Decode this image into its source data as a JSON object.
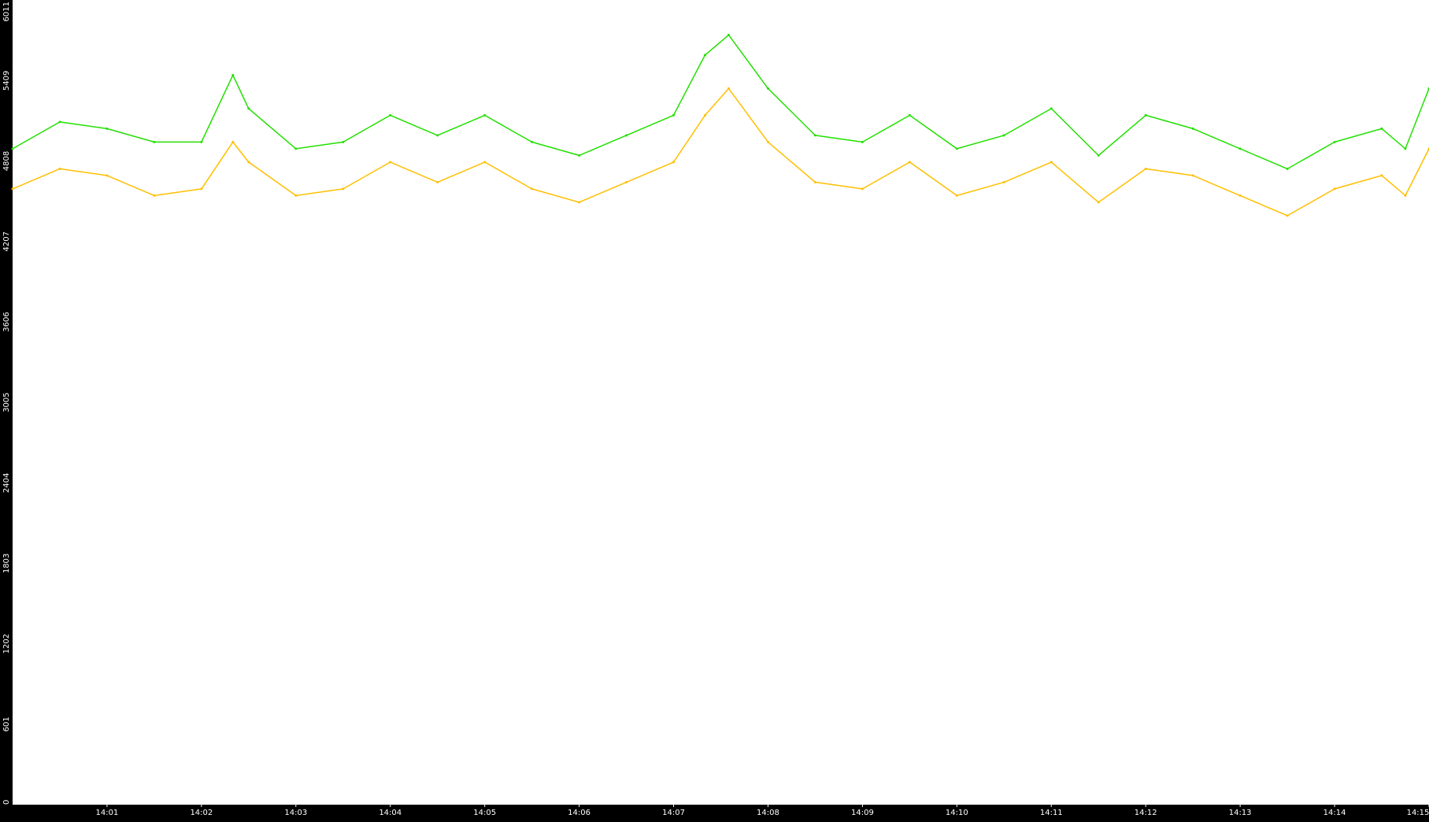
{
  "chart_data": {
    "type": "line",
    "title": "",
    "xlabel": "",
    "ylabel": "",
    "grid": false,
    "legend": "none",
    "colors": {
      "background": "#000000",
      "plot_area": "#ffffff",
      "axis_text": "#ffffff"
    },
    "ylim": [
      0,
      6011
    ],
    "y_ticks": [
      {
        "value": 0,
        "label": "0"
      },
      {
        "value": 601,
        "label": "601"
      },
      {
        "value": 1202,
        "label": "1202"
      },
      {
        "value": 1803,
        "label": "1803"
      },
      {
        "value": 2404,
        "label": "2404"
      },
      {
        "value": 3005,
        "label": "3005"
      },
      {
        "value": 3606,
        "label": "3606"
      },
      {
        "value": 4207,
        "label": "4207"
      },
      {
        "value": 4808,
        "label": "4808"
      },
      {
        "value": 5409,
        "label": "5409"
      },
      {
        "value": 6011,
        "label": "6011"
      }
    ],
    "x_range": [
      "14:00",
      "14:15"
    ],
    "x_ticks": [
      "14:01",
      "14:02",
      "14:03",
      "14:04",
      "14:05",
      "14:06",
      "14:07",
      "14:08",
      "14:09",
      "14:10",
      "14:11",
      "14:12",
      "14:13",
      "14:14",
      "14:15"
    ],
    "series": [
      {
        "color": "#22e000",
        "x": [
          "14:00",
          "14:00:30",
          "14:01",
          "14:01:30",
          "14:02",
          "14:02:20",
          "14:02:30",
          "14:03",
          "14:03:30",
          "14:04",
          "14:04:30",
          "14:05",
          "14:05:30",
          "14:06",
          "14:06:30",
          "14:07",
          "14:07:20",
          "14:07:35",
          "14:08",
          "14:08:30",
          "14:09",
          "14:09:30",
          "14:10",
          "14:10:30",
          "14:11",
          "14:11:30",
          "14:12",
          "14:12:30",
          "14:13",
          "14:13:30",
          "14:14",
          "14:14:30",
          "14:14:45",
          "14:15"
        ],
        "values": [
          4900,
          5100,
          5050,
          4950,
          4950,
          5450,
          5200,
          4900,
          4950,
          5150,
          5000,
          5150,
          4950,
          4850,
          5000,
          5150,
          5600,
          5750,
          5350,
          5000,
          4950,
          5150,
          4900,
          5000,
          5200,
          4850,
          5150,
          5050,
          4900,
          4750,
          4950,
          5050,
          4900,
          5350
        ]
      },
      {
        "color": "#ffbf00",
        "x": [
          "14:00",
          "14:00:30",
          "14:01",
          "14:01:30",
          "14:02",
          "14:02:20",
          "14:02:30",
          "14:03",
          "14:03:30",
          "14:04",
          "14:04:30",
          "14:05",
          "14:05:30",
          "14:06",
          "14:06:30",
          "14:07",
          "14:07:20",
          "14:07:35",
          "14:08",
          "14:08:30",
          "14:09",
          "14:09:30",
          "14:10",
          "14:10:30",
          "14:11",
          "14:11:30",
          "14:12",
          "14:12:30",
          "14:13",
          "14:13:30",
          "14:14",
          "14:14:30",
          "14:14:45",
          "14:15"
        ],
        "values": [
          4600,
          4750,
          4700,
          4550,
          4600,
          4950,
          4800,
          4550,
          4600,
          4800,
          4650,
          4800,
          4600,
          4500,
          4650,
          4800,
          5150,
          5350,
          4950,
          4650,
          4600,
          4800,
          4550,
          4650,
          4800,
          4500,
          4750,
          4700,
          4550,
          4400,
          4600,
          4700,
          4550,
          4900
        ]
      }
    ]
  }
}
